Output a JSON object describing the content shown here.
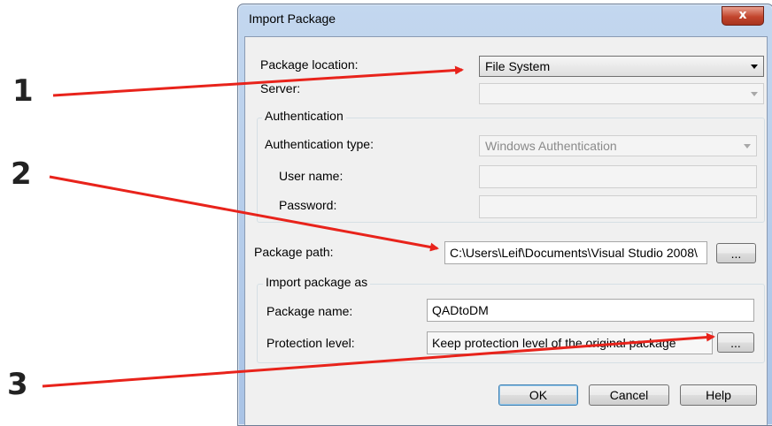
{
  "callouts": [
    "1",
    "2",
    "3"
  ],
  "dialog": {
    "title": "Import Package",
    "close_glyph": "x",
    "package_location": {
      "label": "Package location:",
      "value": "File System"
    },
    "server": {
      "label": "Server:",
      "value": ""
    },
    "authentication": {
      "group_title": "Authentication",
      "type_label": "Authentication type:",
      "type_value": "Windows Authentication",
      "user_label": "User name:",
      "user_value": "",
      "password_label": "Password:",
      "password_value": ""
    },
    "package_path": {
      "label": "Package path:",
      "value": "C:\\Users\\Leif\\Documents\\Visual Studio 2008\\",
      "browse": "..."
    },
    "import_as": {
      "group_title": "Import package as",
      "name_label": "Package name:",
      "name_value": "QADtoDM",
      "protection_label": "Protection level:",
      "protection_value": "Keep protection level of the original package",
      "protection_button": "..."
    },
    "buttons": {
      "ok": "OK",
      "cancel": "Cancel",
      "help": "Help"
    }
  },
  "colors": {
    "arrow": "#e8231b",
    "title_bar": "#b4cbe9",
    "close_button": "#c2452d"
  },
  "icons": {
    "combo_arrow": "chevron-down-icon"
  }
}
